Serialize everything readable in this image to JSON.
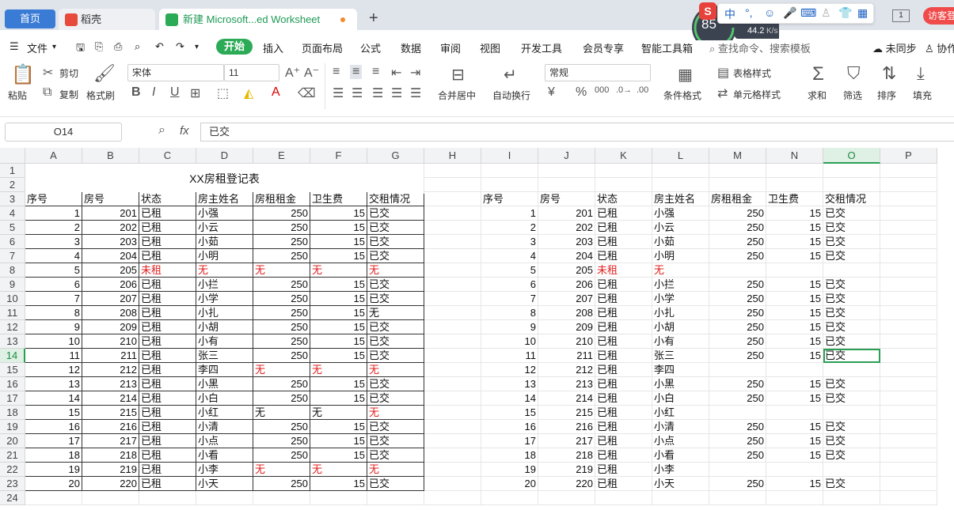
{
  "tabs": {
    "home": "首页",
    "draft": "稻壳",
    "book": "新建 Microsoft...ed Worksheet",
    "add": "+"
  },
  "overlay": {
    "percent": "85",
    "speed": "44.2",
    "speed_unit": "K/s",
    "ime_mode": "中",
    "visitor": "访客登",
    "window_num": "1"
  },
  "menu": {
    "file": "文件",
    "items": [
      "开始",
      "插入",
      "页面布局",
      "公式",
      "数据",
      "审阅",
      "视图",
      "开发工具",
      "会员专享",
      "智能工具箱"
    ],
    "search_placeholder": "查找命令、搜索模板",
    "sync": "未同步",
    "collab": "协作"
  },
  "ribbon": {
    "paste": "粘贴",
    "cut": "剪切",
    "copy": "复制",
    "format_painter": "格式刷",
    "font_name": "宋体",
    "font_size": "11",
    "merge_center": "合并居中",
    "auto_wrap": "自动换行",
    "number_format": "常规",
    "conditional_format": "条件格式",
    "table_style": "表格样式",
    "cell_style": "单元格样式",
    "sum": "求和",
    "filter": "筛选",
    "sort": "排序",
    "fill": "填充"
  },
  "formula": {
    "name_box": "O14",
    "fx": "fx",
    "value": "已交"
  },
  "sheet": {
    "columns": [
      "A",
      "B",
      "C",
      "D",
      "E",
      "F",
      "G",
      "H",
      "I",
      "J",
      "K",
      "L",
      "M",
      "N",
      "O",
      "P"
    ],
    "selected_column": "O",
    "selected_row": 14,
    "rows": [
      "1",
      "2",
      "3",
      "4",
      "5",
      "6",
      "7",
      "8",
      "9",
      "10",
      "11",
      "12",
      "13",
      "14",
      "15",
      "16",
      "17",
      "18",
      "19",
      "20",
      "21",
      "22",
      "23",
      "24"
    ],
    "left_title": "XX房租登记表",
    "headers": [
      "序号",
      "房号",
      "状态",
      "房主姓名",
      "房租租金",
      "卫生费",
      "交租情况"
    ],
    "left_records": [
      [
        "1",
        "201",
        "已租",
        "小强",
        "250",
        "15",
        "已交"
      ],
      [
        "2",
        "202",
        "已租",
        "小云",
        "250",
        "15",
        "已交"
      ],
      [
        "3",
        "203",
        "已租",
        "小茹",
        "250",
        "15",
        "已交"
      ],
      [
        "4",
        "204",
        "已租",
        "小明",
        "250",
        "15",
        "已交"
      ],
      [
        "5",
        "205",
        "未租",
        "无",
        "无",
        "无",
        "无"
      ],
      [
        "6",
        "206",
        "已租",
        "小拦",
        "250",
        "15",
        "已交"
      ],
      [
        "7",
        "207",
        "已租",
        "小学",
        "250",
        "15",
        "已交"
      ],
      [
        "8",
        "208",
        "已租",
        "小扎",
        "250",
        "15",
        "无"
      ],
      [
        "9",
        "209",
        "已租",
        "小胡",
        "250",
        "15",
        "已交"
      ],
      [
        "10",
        "210",
        "已租",
        "小有",
        "250",
        "15",
        "已交"
      ],
      [
        "11",
        "211",
        "已租",
        "张三",
        "250",
        "15",
        "已交"
      ],
      [
        "12",
        "212",
        "已租",
        "李四",
        "无",
        "无",
        "无"
      ],
      [
        "13",
        "213",
        "已租",
        "小黑",
        "250",
        "15",
        "已交"
      ],
      [
        "14",
        "214",
        "已租",
        "小白",
        "250",
        "15",
        "已交"
      ],
      [
        "15",
        "215",
        "已租",
        "小红",
        "无",
        "无",
        "无"
      ],
      [
        "16",
        "216",
        "已租",
        "小清",
        "250",
        "15",
        "已交"
      ],
      [
        "17",
        "217",
        "已租",
        "小点",
        "250",
        "15",
        "已交"
      ],
      [
        "18",
        "218",
        "已租",
        "小看",
        "250",
        "15",
        "已交"
      ],
      [
        "19",
        "219",
        "已租",
        "小李",
        "无",
        "无",
        "无"
      ],
      [
        "20",
        "220",
        "已租",
        "小天",
        "250",
        "15",
        "已交"
      ]
    ],
    "right_records": [
      [
        "1",
        "201",
        "已租",
        "小强",
        "250",
        "15",
        "已交"
      ],
      [
        "2",
        "202",
        "已租",
        "小云",
        "250",
        "15",
        "已交"
      ],
      [
        "3",
        "203",
        "已租",
        "小茹",
        "250",
        "15",
        "已交"
      ],
      [
        "4",
        "204",
        "已租",
        "小明",
        "250",
        "15",
        "已交"
      ],
      [
        "5",
        "205",
        "未租",
        "无",
        "",
        "",
        ""
      ],
      [
        "6",
        "206",
        "已租",
        "小拦",
        "250",
        "15",
        "已交"
      ],
      [
        "7",
        "207",
        "已租",
        "小学",
        "250",
        "15",
        "已交"
      ],
      [
        "8",
        "208",
        "已租",
        "小扎",
        "250",
        "15",
        "已交"
      ],
      [
        "9",
        "209",
        "已租",
        "小胡",
        "250",
        "15",
        "已交"
      ],
      [
        "10",
        "210",
        "已租",
        "小有",
        "250",
        "15",
        "已交"
      ],
      [
        "11",
        "211",
        "已租",
        "张三",
        "250",
        "15",
        "已交"
      ],
      [
        "12",
        "212",
        "已租",
        "李四",
        "",
        "",
        ""
      ],
      [
        "13",
        "213",
        "已租",
        "小黑",
        "250",
        "15",
        "已交"
      ],
      [
        "14",
        "214",
        "已租",
        "小白",
        "250",
        "15",
        "已交"
      ],
      [
        "15",
        "215",
        "已租",
        "小红",
        "",
        "",
        ""
      ],
      [
        "16",
        "216",
        "已租",
        "小清",
        "250",
        "15",
        "已交"
      ],
      [
        "17",
        "217",
        "已租",
        "小点",
        "250",
        "15",
        "已交"
      ],
      [
        "18",
        "218",
        "已租",
        "小看",
        "250",
        "15",
        "已交"
      ],
      [
        "19",
        "219",
        "已租",
        "小李",
        "",
        "",
        ""
      ],
      [
        "20",
        "220",
        "已租",
        "小天",
        "250",
        "15",
        "已交"
      ]
    ],
    "left_red_cells": [
      [
        4,
        2
      ],
      [
        4,
        3
      ],
      [
        4,
        4
      ],
      [
        4,
        5
      ],
      [
        4,
        6
      ],
      [
        11,
        4
      ],
      [
        11,
        5
      ],
      [
        11,
        6
      ],
      [
        14,
        6
      ],
      [
        18,
        4
      ],
      [
        18,
        5
      ],
      [
        18,
        6
      ]
    ],
    "right_red_cells": [
      [
        4,
        2
      ],
      [
        4,
        3
      ]
    ]
  },
  "colors": {
    "accent": "#2cab57",
    "tab_home": "#3a7bd5",
    "red_text": "#e02020"
  }
}
